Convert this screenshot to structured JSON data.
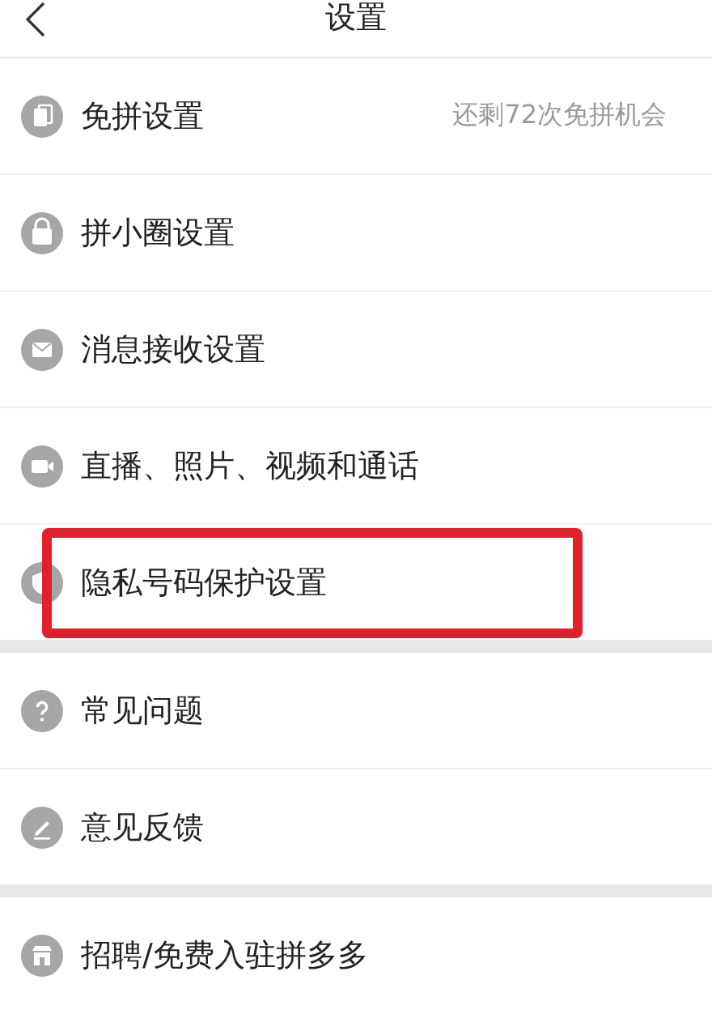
{
  "header": {
    "title": "设置"
  },
  "groups": [
    {
      "items": [
        {
          "kind": "card",
          "label": "免拼设置",
          "hint": "还剩72次免拼机会",
          "highlighted": false
        },
        {
          "kind": "lock",
          "label": "拼小圈设置",
          "highlighted": false
        },
        {
          "kind": "mail",
          "label": "消息接收设置",
          "highlighted": false
        },
        {
          "kind": "camera",
          "label": "直播、照片、视频和通话",
          "highlighted": false
        },
        {
          "kind": "shield",
          "label": "隐私号码保护设置",
          "highlighted": true
        }
      ]
    },
    {
      "items": [
        {
          "kind": "question",
          "label": "常见问题",
          "highlighted": false
        },
        {
          "kind": "pencil",
          "label": "意见反馈",
          "highlighted": false
        }
      ]
    },
    {
      "items": [
        {
          "kind": "shop",
          "label": "招聘/免费入驻拼多多",
          "highlighted": false
        }
      ]
    }
  ]
}
